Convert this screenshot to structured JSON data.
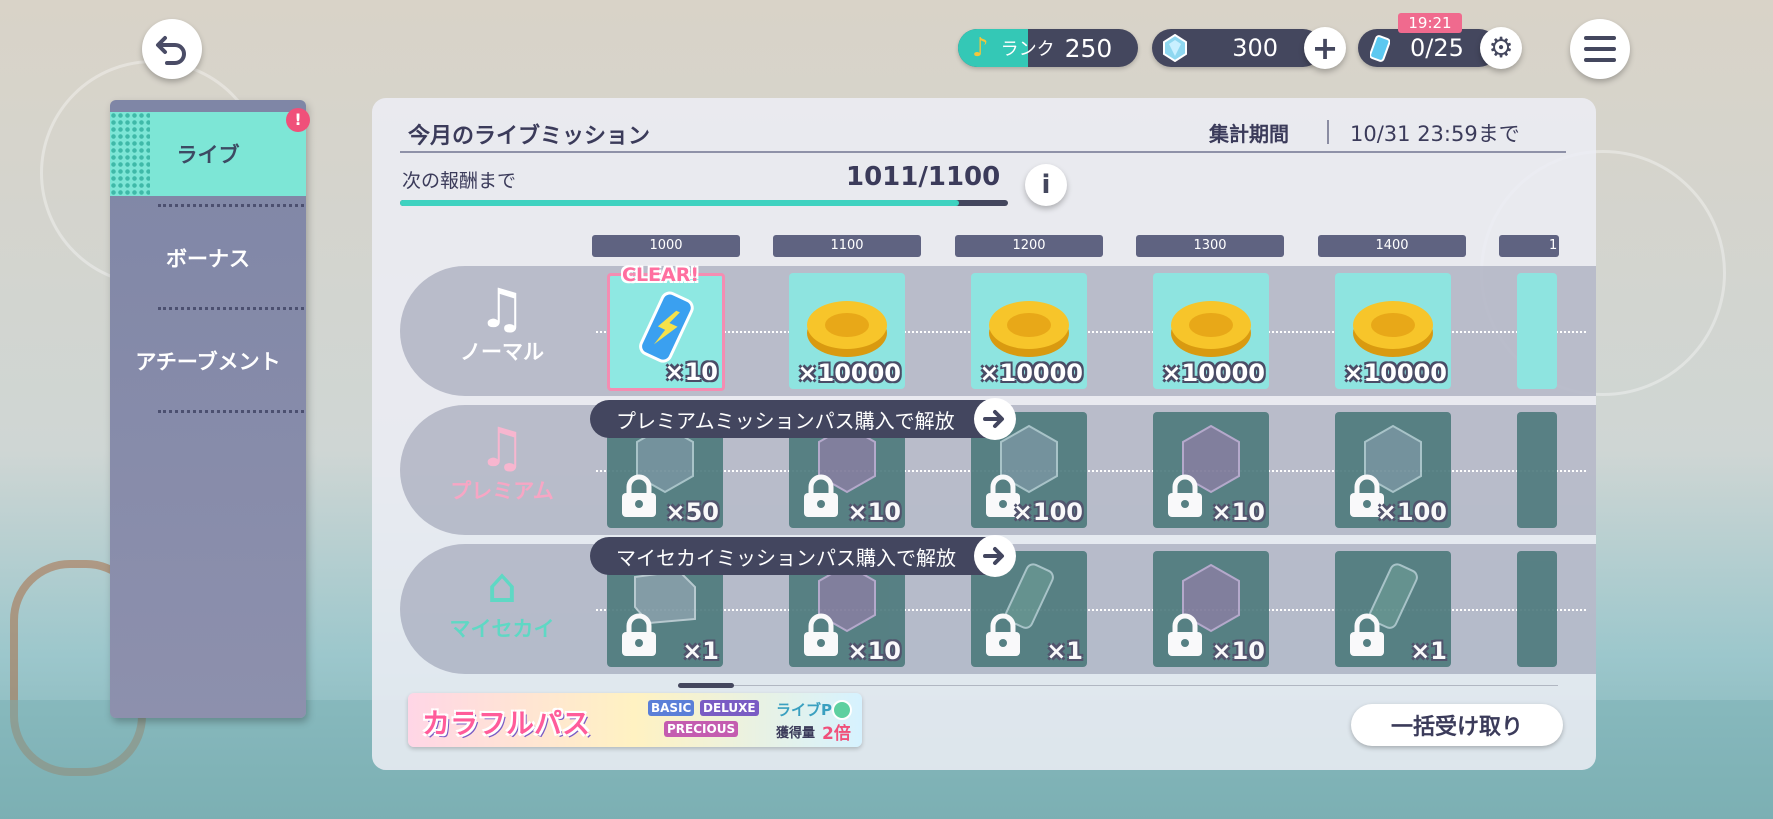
{
  "header": {
    "rank_label": "ランク",
    "rank_value": "250",
    "gems": "300",
    "clock": "19:21",
    "stamina": "0/25"
  },
  "sidebar": {
    "items": [
      {
        "label": "ライブ",
        "active": true,
        "badge": "!"
      },
      {
        "label": "ボーナス",
        "active": false
      },
      {
        "label": "アチーブメント",
        "active": false
      }
    ]
  },
  "mission": {
    "title": "今月のライブミッション",
    "period_label": "集計期間",
    "period_value": "10/31 23:59まで",
    "next_reward_label": "次の報酬まで",
    "progress_text": "1011/1100",
    "progress": 0.92,
    "info_button": "i",
    "tiers": [
      "1000",
      "1100",
      "1200",
      "1300",
      "1400",
      "1"
    ]
  },
  "tracks": [
    {
      "name": "ノーマル",
      "locked": false,
      "rewards": [
        {
          "icon": "energy-drink-icon",
          "qty": "×10",
          "clear": "CLEAR!"
        },
        {
          "icon": "coin-icon",
          "qty": "×10000"
        },
        {
          "icon": "coin-icon",
          "qty": "×10000"
        },
        {
          "icon": "coin-icon",
          "qty": "×10000"
        },
        {
          "icon": "coin-icon",
          "qty": "×10000"
        }
      ]
    },
    {
      "name": "プレミアム",
      "locked": true,
      "unlock_text": "プレミアムミッションパス購入で解放",
      "rewards": [
        {
          "icon": "crystal-icon",
          "qty": "×50"
        },
        {
          "icon": "crystal-icon",
          "qty": "×10"
        },
        {
          "icon": "crystal-icon",
          "qty": "×100"
        },
        {
          "icon": "crystal-icon",
          "qty": "×10"
        },
        {
          "icon": "crystal-icon",
          "qty": "×100"
        }
      ]
    },
    {
      "name": "マイセカイ",
      "locked": true,
      "unlock_text": "マイセカイミッションパス購入で解放",
      "rewards": [
        {
          "icon": "material-icon",
          "qty": "×1"
        },
        {
          "icon": "crystal-icon",
          "qty": "×10"
        },
        {
          "icon": "energy-drink-icon",
          "qty": "×1"
        },
        {
          "icon": "crystal-icon",
          "qty": "×10"
        },
        {
          "icon": "energy-drink-icon",
          "qty": "×1"
        }
      ]
    }
  ],
  "banner": {
    "title": "カラフルパス",
    "tags": [
      "BASIC",
      "DELUXE",
      "PRECIOUS"
    ],
    "line1": "ライブP",
    "line2_prefix": "獲得量",
    "line2_emph": "2倍"
  },
  "claim_all_button": "一括受け取り",
  "colors": {
    "accent": "#3fd2c0",
    "panel_dark": "#44475e",
    "badge": "#f0507a"
  }
}
